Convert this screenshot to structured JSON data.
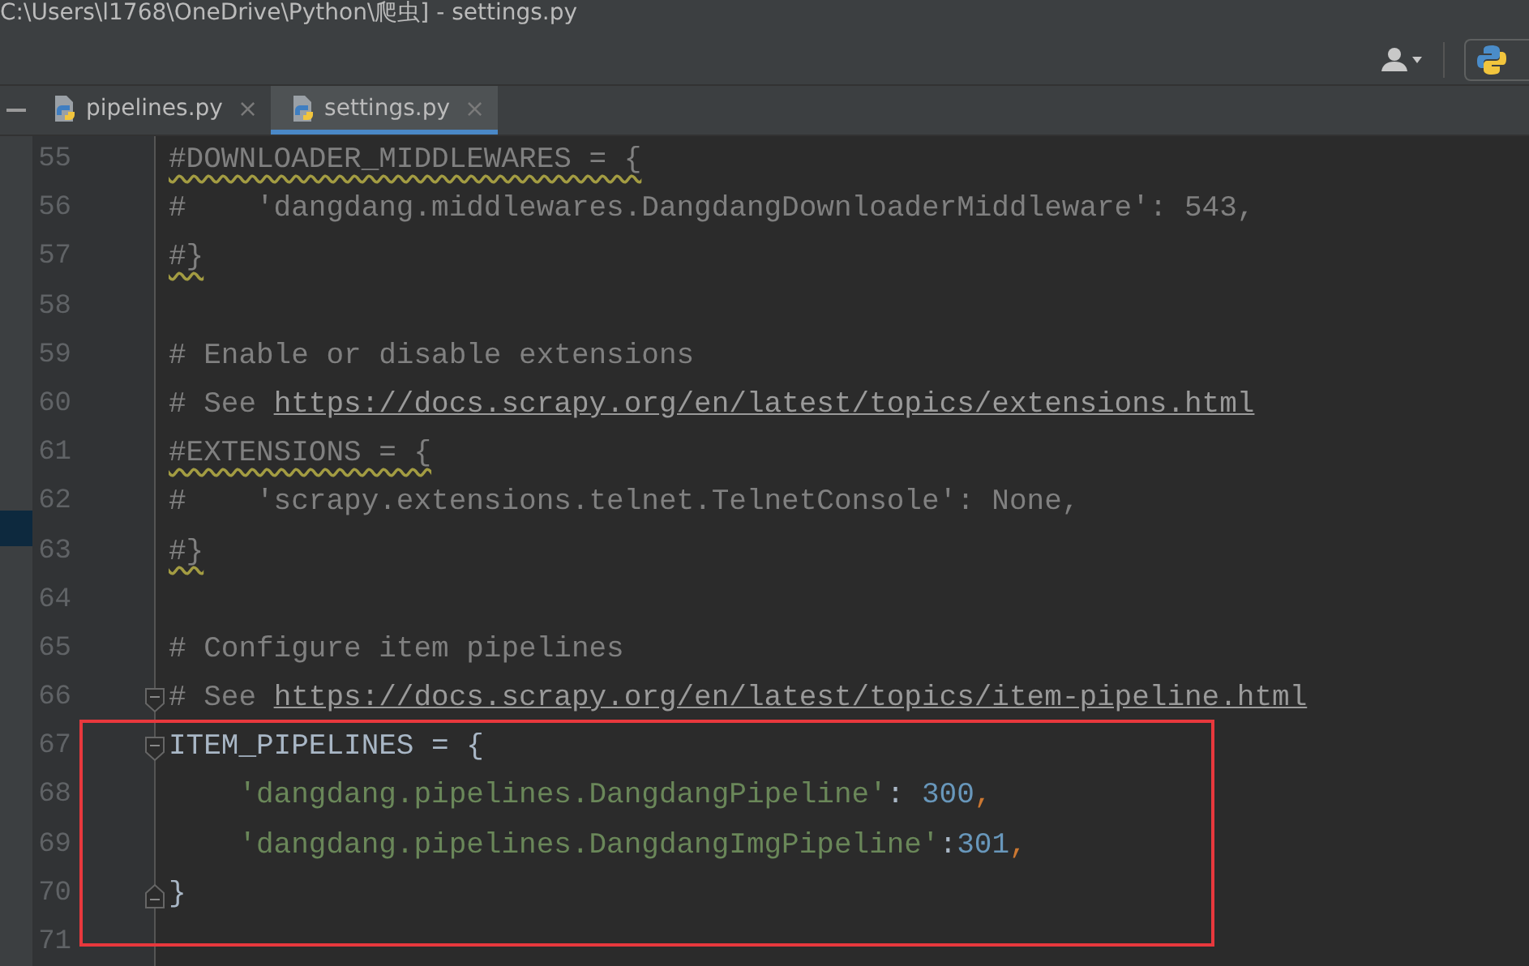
{
  "window": {
    "title": "C:\\Users\\l1768\\OneDrive\\Python\\爬虫] - settings.py"
  },
  "tabs": [
    {
      "label": "pipelines.py",
      "close": "×",
      "selected": false
    },
    {
      "label": "settings.py",
      "close": "×",
      "selected": true
    }
  ],
  "editor": {
    "lines": [
      {
        "number": "55",
        "fold_start": false,
        "fold_end": false,
        "tokens": [
          {
            "kind": "comment",
            "text": "#DOWNLOADER_MIDDLEWARES = {",
            "squiggle": true
          }
        ]
      },
      {
        "number": "56",
        "fold_start": false,
        "fold_end": false,
        "tokens": [
          {
            "kind": "comment",
            "text": "#    'dangdang.middlewares.DangdangDownloaderMiddleware': 543,"
          }
        ]
      },
      {
        "number": "57",
        "fold_start": false,
        "fold_end": false,
        "tokens": [
          {
            "kind": "comment",
            "text": "#}",
            "squiggle": true
          }
        ]
      },
      {
        "number": "58",
        "fold_start": false,
        "fold_end": false
      },
      {
        "number": "59",
        "fold_start": false,
        "fold_end": false,
        "tokens": [
          {
            "kind": "comment",
            "text": "# Enable or disable extensions"
          }
        ]
      },
      {
        "number": "60",
        "fold_start": false,
        "fold_end": false,
        "tokens": [
          {
            "kind": "comment",
            "text": "# See "
          },
          {
            "kind": "link",
            "text": "https://docs.scrapy.org/en/latest/topics/extensions.html"
          }
        ]
      },
      {
        "number": "61",
        "fold_start": false,
        "fold_end": false,
        "tokens": [
          {
            "kind": "comment",
            "text": "#EXTENSIONS = {",
            "squiggle": true
          }
        ]
      },
      {
        "number": "62",
        "fold_start": false,
        "fold_end": false,
        "tokens": [
          {
            "kind": "comment",
            "text": "#    'scrapy.extensions.telnet.TelnetConsole': None,"
          }
        ]
      },
      {
        "number": "63",
        "fold_start": false,
        "fold_end": false,
        "tokens": [
          {
            "kind": "comment",
            "text": "#}",
            "squiggle": true
          }
        ]
      },
      {
        "number": "64",
        "fold_start": false,
        "fold_end": false
      },
      {
        "number": "65",
        "fold_start": false,
        "fold_end": false,
        "tokens": [
          {
            "kind": "comment",
            "text": "# Configure item pipelines"
          }
        ]
      },
      {
        "number": "66",
        "fold_start": true,
        "fold_end": false,
        "tokens": [
          {
            "kind": "comment",
            "text": "# See "
          },
          {
            "kind": "link",
            "text": "https://docs.scrapy.org/en/latest/topics/item-pipeline.html"
          }
        ]
      },
      {
        "number": "67",
        "fold_start": true,
        "fold_end": false,
        "tokens": [
          {
            "kind": "plain",
            "text": "ITEM_PIPELINES = {"
          }
        ]
      },
      {
        "number": "68",
        "fold_start": false,
        "fold_end": false,
        "tokens": [
          {
            "kind": "string",
            "text": "    'dangdang.pipelines.DangdangPipeline'"
          },
          {
            "kind": "plain",
            "text": ": "
          },
          {
            "kind": "number",
            "text": "300"
          },
          {
            "kind": "keyword",
            "text": ","
          }
        ]
      },
      {
        "number": "69",
        "fold_start": false,
        "fold_end": false,
        "tokens": [
          {
            "kind": "string",
            "text": "    'dangdang.pipelines.DangdangImgPipeline'"
          },
          {
            "kind": "plain",
            "text": ":"
          },
          {
            "kind": "number",
            "text": "301"
          },
          {
            "kind": "keyword",
            "text": ","
          }
        ]
      },
      {
        "number": "70",
        "fold_start": false,
        "fold_end": true,
        "tokens": [
          {
            "kind": "plain",
            "text": "}"
          }
        ]
      },
      {
        "number": "71",
        "fold_start": false,
        "fold_end": false
      }
    ]
  }
}
